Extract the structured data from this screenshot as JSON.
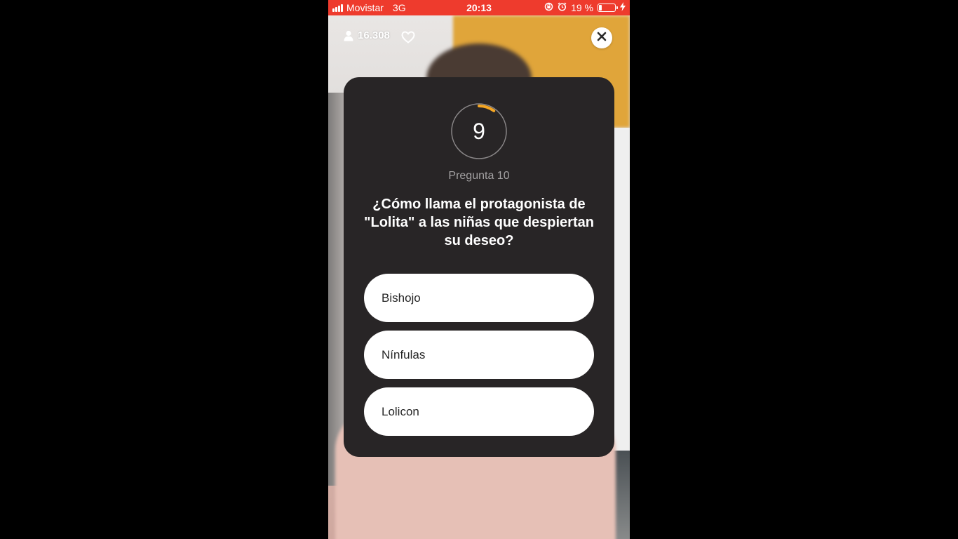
{
  "status_bar": {
    "carrier": "Movistar",
    "network": "3G",
    "time": "20:13",
    "battery_percent": "19 %",
    "battery_level": 0.19,
    "icons": [
      "signal-icon",
      "rotation-lock-icon",
      "alarm-icon",
      "battery-icon",
      "charging-bolt-icon"
    ]
  },
  "stream": {
    "viewer_count": "16.308",
    "viewer_icon": "person-icon",
    "like_icon": "heart-icon",
    "close_icon": "close-icon"
  },
  "quiz": {
    "timer_value": "9",
    "timer_progress": 0.1,
    "timer_color": "#f5a623",
    "question_label": "Pregunta 10",
    "question_text": "¿Cómo llama el protagonista de \"Lolita\" a las niñas que despiertan su deseo?",
    "answers": [
      {
        "label": "Bishojo"
      },
      {
        "label": "Nínfulas"
      },
      {
        "label": "Lolicon"
      }
    ]
  },
  "colors": {
    "status_bar": "#ee3b2d",
    "card_background": "#282526",
    "answer_background": "#ffffff"
  }
}
